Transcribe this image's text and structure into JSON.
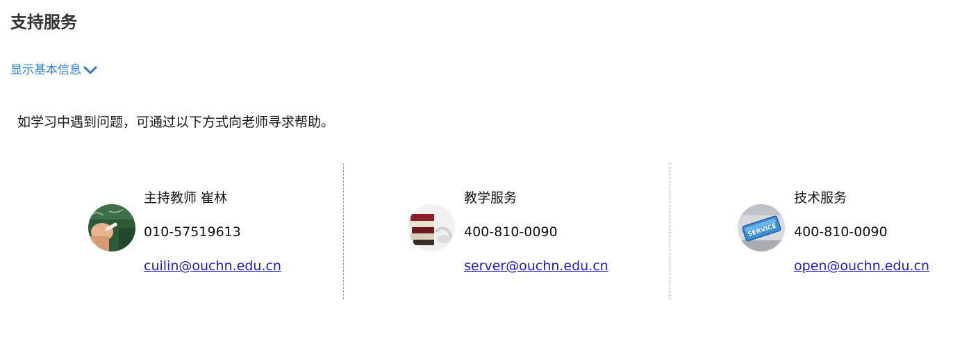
{
  "page": {
    "title": "支持服务",
    "toggle_label": "显示基本信息",
    "intro": "如学习中遇到问题，可通过以下方式向老师寻求帮助。"
  },
  "contacts": [
    {
      "role": "主持教师 崔林",
      "phone": "010-57519613",
      "email": "cuilin@ouchn.edu.cn",
      "avatar_icon": "teacher-writing-on-chalkboard"
    },
    {
      "role": "教学服务",
      "phone": "400-810-0090",
      "email": "server@ouchn.edu.cn",
      "avatar_icon": "books-and-headphones"
    },
    {
      "role": "技术服务",
      "phone": "400-810-0090",
      "email": "open@ouchn.edu.cn",
      "avatar_icon": "service-keyboard-key"
    }
  ],
  "colors": {
    "link": "#2a7ad1",
    "email_link": "#1a1ad6",
    "title": "#333333",
    "divider": "#9a9a9a"
  }
}
